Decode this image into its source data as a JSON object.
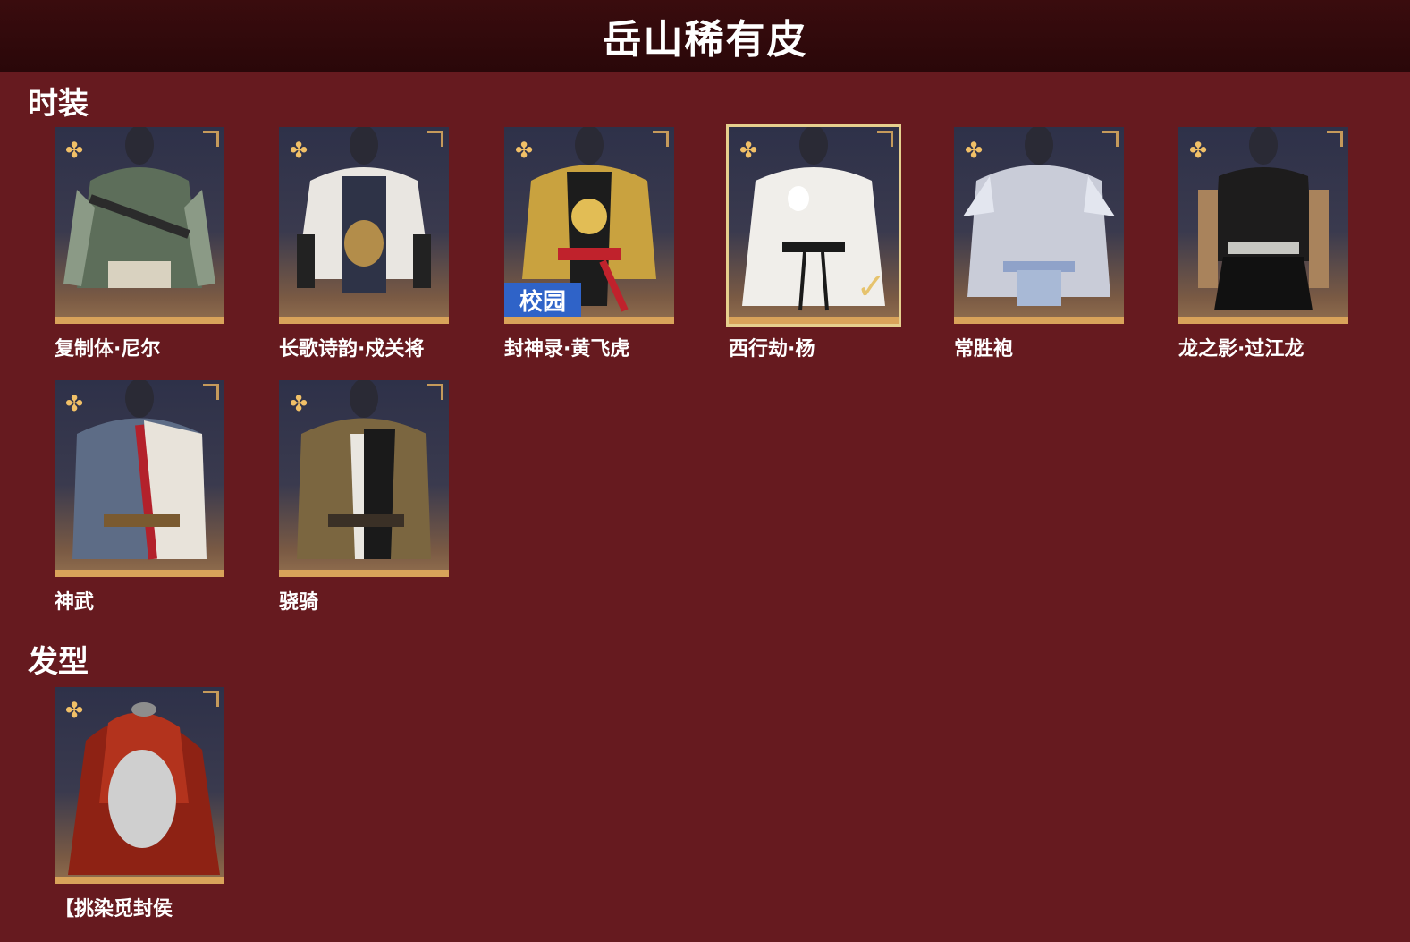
{
  "page": {
    "title": "岳山稀有皮"
  },
  "sections": [
    {
      "title": "时装",
      "items": [
        {
          "name": "复制体·尼尔",
          "palette": "green"
        },
        {
          "name": "长歌诗韵·戍关将",
          "palette": "white"
        },
        {
          "name": "封神录·黄飞虎",
          "palette": "gold",
          "badge": "校园"
        },
        {
          "name": "西行劫·杨",
          "palette": "white2",
          "selected": true
        },
        {
          "name": "常胜袍",
          "palette": "silver"
        },
        {
          "name": "龙之影·过江龙",
          "palette": "black"
        },
        {
          "name": "神武",
          "palette": "armor"
        },
        {
          "name": "骁骑",
          "palette": "bronze"
        }
      ]
    },
    {
      "title": "发型",
      "items": [
        {
          "name": "【挑染觅封侯",
          "palette": "hair"
        }
      ]
    }
  ],
  "icons": {
    "rarity": "rarity-star-icon",
    "corner": "corner-leaf-icon",
    "check": "check-icon"
  },
  "colors": {
    "background": "#661a1f",
    "header": "#2a0709",
    "accent": "#d9a35a",
    "badge": "#2f63c8"
  }
}
